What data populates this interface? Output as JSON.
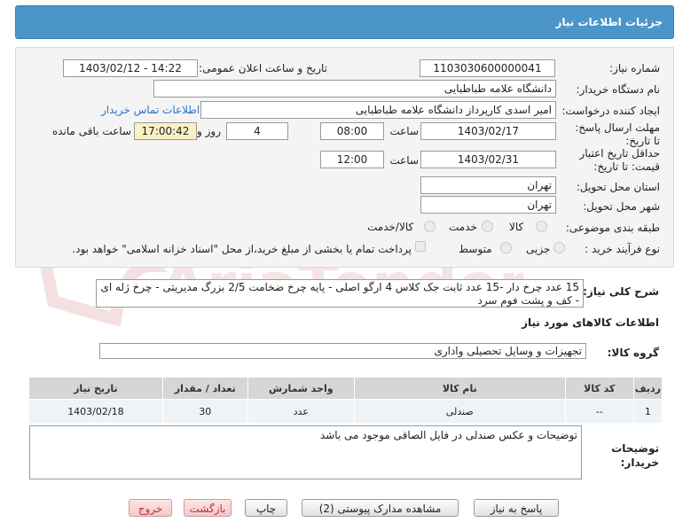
{
  "header": {
    "title": "جزئیات اطلاعات نیاز"
  },
  "form": {
    "need_number_label": "شماره نیاز:",
    "need_number": "1103030600000041",
    "announce_label": "تاریخ و ساعت اعلان عمومی:",
    "announce_value": "1403/02/12 - 14:22",
    "buyer_label": "نام دستگاه خریدار:",
    "buyer_value": "دانشگاه علامه طباطبایی",
    "creator_label": "ایجاد کننده درخواست:",
    "creator_value": "امیر اسدی کارپرداز دانشگاه علامه طباطبایی",
    "contact_link": "اطلاعات تماس خریدار",
    "deadline_label": "مهلت ارسال پاسخ: تا تاریخ:",
    "deadline_date": "1403/02/17",
    "time_label": "ساعت",
    "deadline_time": "08:00",
    "days_value": "4",
    "days_label": "روز و",
    "remaining_time": "17:00:42",
    "remaining_label": "ساعت باقی مانده",
    "validity_label": "حداقل تاریخ اعتبار قیمت: تا تاریخ:",
    "validity_date": "1403/02/31",
    "validity_time": "12:00",
    "province_label": "استان محل تحویل:",
    "province_value": "تهران",
    "city_label": "شهر محل تحویل:",
    "city_value": "تهران",
    "category_label": "طبقه بندی موضوعی:",
    "category_options": [
      "کالا",
      "خدمت",
      "کالا/خدمت"
    ],
    "process_label": "نوع فرآیند خرید :",
    "process_options": [
      "جزیی",
      "متوسط"
    ],
    "payment_note": "پرداخت تمام یا بخشی از مبلغ خرید،از محل \"اسناد خزانه اسلامی\" خواهد بود."
  },
  "summary": {
    "label": "شرح کلی نیاز:",
    "text": "15 عدد چرخ دار -15 عدد ثابت جک کلاس 4 ارگو اصلی - پایه چرخ ضخامت 2/5 بزرگ مدیریتی - چرخ ژله ای - کف و پشت فوم سرد"
  },
  "goods": {
    "section_title": "اطلاعات کالاهای مورد نیاز",
    "group_label": "گروه کالا:",
    "group_value": "تجهیزات و وسایل تحصیلی واداری",
    "table": {
      "headers": [
        "ردیف",
        "کد کالا",
        "نام کالا",
        "واحد شمارش",
        "تعداد / مقدار",
        "تاریخ نیاز"
      ],
      "rows": [
        [
          "1",
          "--",
          "صندلی",
          "عدد",
          "30",
          "1403/02/18"
        ]
      ]
    }
  },
  "buyer_notes": {
    "label": "توضیحات خریدار:",
    "text": "توضیحات  و عکس صندلی در فایل الصاقی موجود می باشد"
  },
  "buttons": {
    "reply": "پاسخ به نیاز",
    "docs": "مشاهده مدارک پیوستی (2)",
    "print": "چاپ",
    "back": "بازگشت",
    "exit": "خروج"
  },
  "colors": {
    "header_bg": "#4b95c9",
    "link": "#2d6fd0",
    "highlight": "#f8f1c4"
  }
}
